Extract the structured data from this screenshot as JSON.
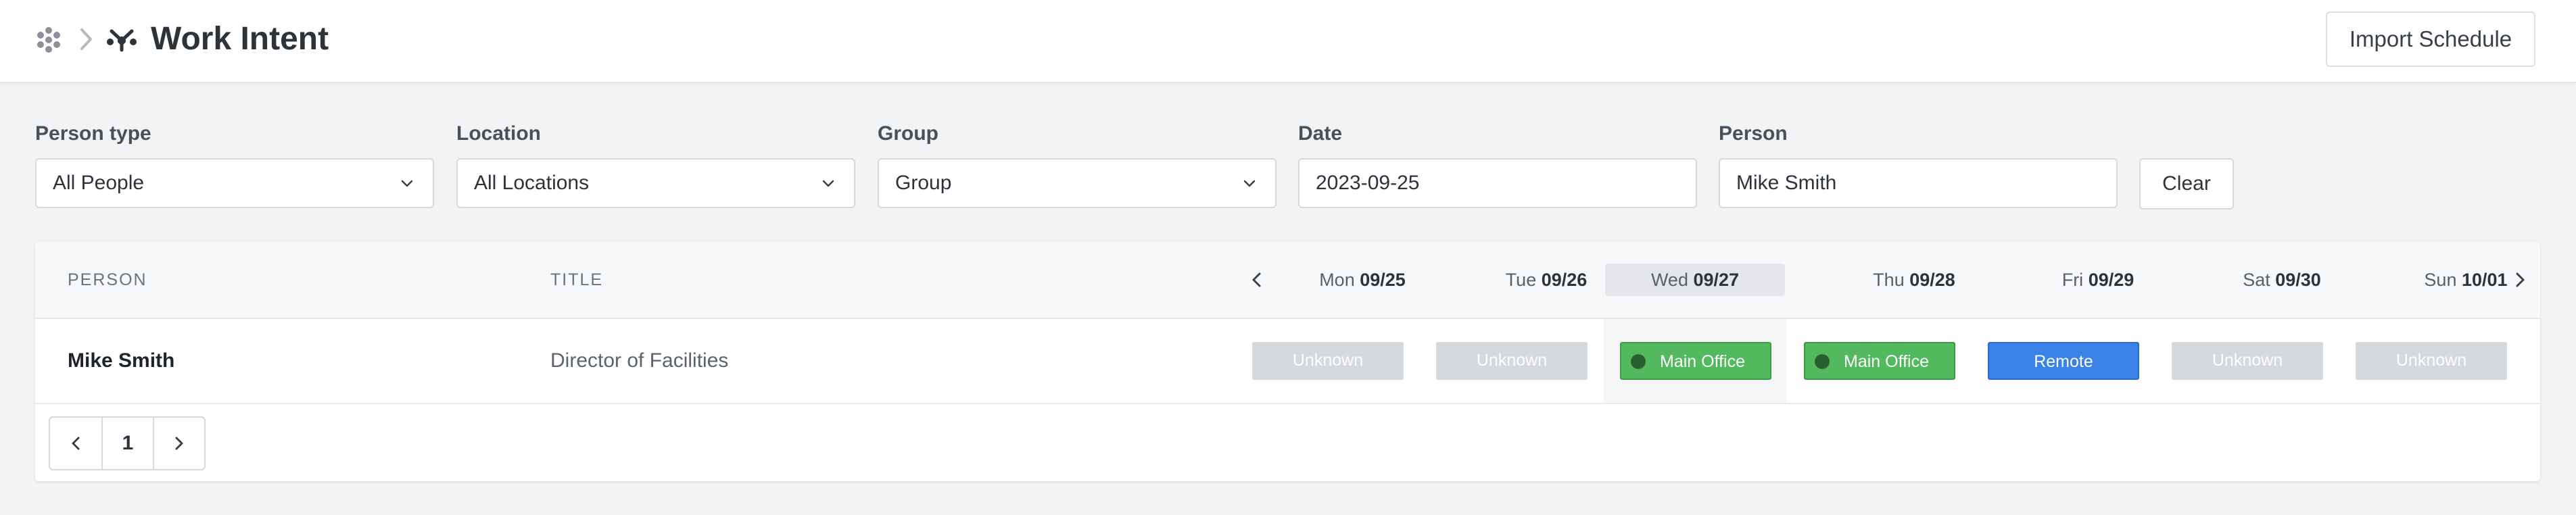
{
  "header": {
    "title": "Work Intent",
    "import_label": "Import Schedule"
  },
  "filters": [
    {
      "label": "Person type",
      "value": "All People",
      "kind": "select"
    },
    {
      "label": "Location",
      "value": "All Locations",
      "kind": "select"
    },
    {
      "label": "Group",
      "value": "Group",
      "kind": "select"
    },
    {
      "label": "Date",
      "value": "2023-09-25",
      "kind": "text"
    },
    {
      "label": "Person",
      "value": "Mike Smith",
      "kind": "text"
    }
  ],
  "clear_label": "Clear",
  "table": {
    "col_person": "PERSON",
    "col_title": "TITLE",
    "days": [
      {
        "dow": "Mon",
        "date": "09/25"
      },
      {
        "dow": "Tue",
        "date": "09/26"
      },
      {
        "dow": "Wed",
        "date": "09/27",
        "today": true
      },
      {
        "dow": "Thu",
        "date": "09/28"
      },
      {
        "dow": "Fri",
        "date": "09/29"
      },
      {
        "dow": "Sat",
        "date": "09/30"
      },
      {
        "dow": "Sun",
        "date": "10/01"
      }
    ],
    "rows": [
      {
        "name": "Mike Smith",
        "title": "Director of Facilities",
        "statuses": [
          {
            "label": "Unknown",
            "kind": "unknown"
          },
          {
            "label": "Unknown",
            "kind": "unknown"
          },
          {
            "label": "Main Office",
            "kind": "office"
          },
          {
            "label": "Main Office",
            "kind": "office"
          },
          {
            "label": "Remote",
            "kind": "remote"
          },
          {
            "label": "Unknown",
            "kind": "unknown"
          },
          {
            "label": "Unknown",
            "kind": "unknown"
          }
        ]
      }
    ]
  },
  "pagination": {
    "current_page": "1"
  },
  "colors": {
    "office": "#52b95e",
    "remote": "#3b82e6",
    "unknown": "#d5d8dc"
  }
}
